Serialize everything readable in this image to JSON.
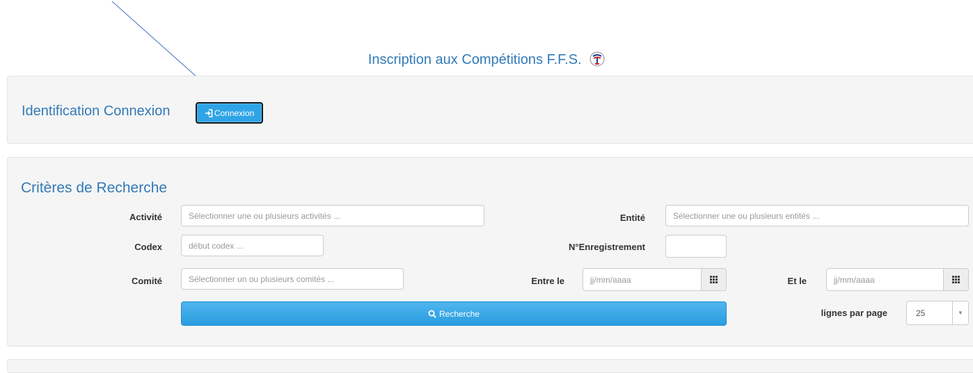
{
  "page": {
    "title": "Inscription aux Compétitions F.F.S.",
    "logo_icon": "ffs-logo-icon"
  },
  "identification": {
    "label": "Identification Connexion",
    "login_button": "Connexion",
    "login_icon": "sign-in-icon"
  },
  "search": {
    "title": "Critères de Recherche",
    "activite": {
      "label": "Activité",
      "placeholder": "Sélectionner une ou plusieurs activités ..."
    },
    "entite": {
      "label": "Entité",
      "placeholder": "Sélectionner une ou plusieurs entités ..."
    },
    "codex": {
      "label": "Codex",
      "placeholder": "début codex ..."
    },
    "enregistrement": {
      "label": "N°Enregistrement",
      "value": ""
    },
    "comite": {
      "label": "Comité",
      "placeholder": "Sélectionner un ou plusieurs comités ..."
    },
    "date_from": {
      "label": "Entre le",
      "placeholder": "jj/mm/aaaa",
      "icon": "calendar-icon"
    },
    "date_to": {
      "label": "Et le",
      "placeholder": "jj/mm/aaaa",
      "icon": "calendar-icon"
    },
    "search_button": "Recherche",
    "search_icon": "search-icon",
    "rows_per_page": {
      "label": "lignes par page",
      "value": "25"
    }
  },
  "colors": {
    "accent": "#337ab7",
    "button": "#2fa4e7",
    "panel": "#f5f5f5",
    "annotation_arrow": "#4472c4"
  }
}
